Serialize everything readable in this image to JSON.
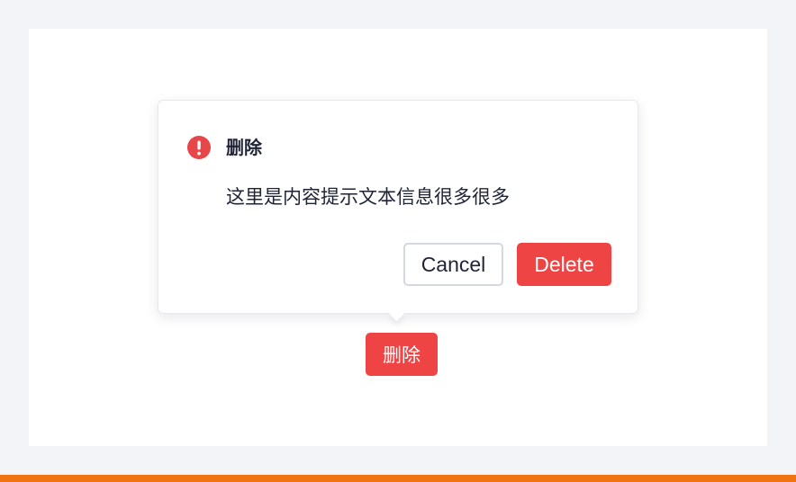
{
  "popconfirm": {
    "icon": "exclamation-circle-icon",
    "title": "删除",
    "content": "这里是内容提示文本信息很多很多",
    "cancel_label": "Cancel",
    "confirm_label": "Delete"
  },
  "trigger": {
    "label": "删除"
  },
  "colors": {
    "danger": "#ef4444",
    "page_background": "#f3f4f8",
    "bottom_bar": "#f07314",
    "text": "#1f2336"
  }
}
